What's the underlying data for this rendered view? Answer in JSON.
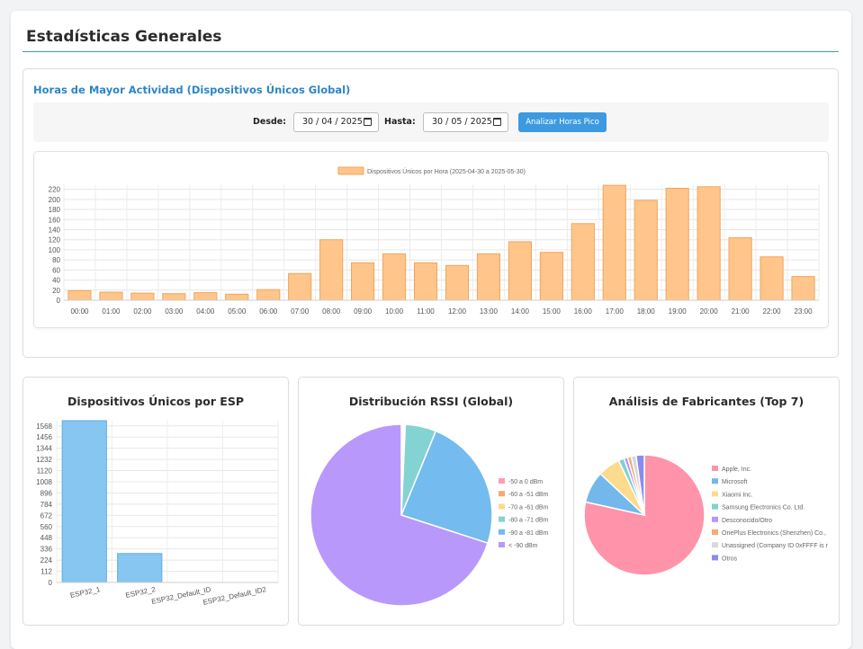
{
  "page": {
    "title": "Estadísticas Generales"
  },
  "peak_hours": {
    "title": "Horas de Mayor Actividad (Dispositivos Únicos Global)",
    "from_label": "Desde:",
    "from_value": "30 / 04 / 2025",
    "to_label": "Hasta:",
    "to_value": "30 / 05 / 2025",
    "analyze_button": "Analizar Horas Pico"
  },
  "esp_card": {
    "title": "Dispositivos Únicos por ESP"
  },
  "rssi_card": {
    "title": "Distribución RSSI (Global)"
  },
  "mfr_card": {
    "title": "Análisis de Fabricantes (Top 7)"
  },
  "chart_data": [
    {
      "type": "bar",
      "legend": "Dispositivos Únicos por Hora (2025-04-30 a 2025-05-30)",
      "categories": [
        "00:00",
        "01:00",
        "02:00",
        "03:00",
        "04:00",
        "05:00",
        "06:00",
        "07:00",
        "08:00",
        "09:00",
        "10:00",
        "11:00",
        "12:00",
        "13:00",
        "14:00",
        "15:00",
        "16:00",
        "17:00",
        "18:00",
        "19:00",
        "20:00",
        "21:00",
        "22:00",
        "23:00"
      ],
      "values": [
        19,
        16,
        14,
        13,
        15,
        12,
        21,
        53,
        120,
        74,
        92,
        74,
        69,
        92,
        116,
        95,
        152,
        228,
        198,
        222,
        225,
        124,
        86,
        47
      ],
      "ylim": [
        0,
        230
      ],
      "yticks": [
        0,
        20,
        40,
        60,
        80,
        100,
        120,
        140,
        160,
        180,
        200,
        220
      ],
      "color": "#ffc58a",
      "border": "#f3a55a",
      "grid": true
    },
    {
      "type": "bar",
      "categories": [
        "ESP32_1",
        "ESP32_2",
        "ESP32_Default_ID",
        "ESP32_Default_ID2"
      ],
      "values": [
        1620,
        290,
        0,
        0
      ],
      "ylim": [
        0,
        1620
      ],
      "yticks": [
        0,
        112,
        224,
        336,
        448,
        560,
        672,
        784,
        896,
        1008,
        1120,
        1232,
        1344,
        1456,
        1568
      ],
      "color": "#87c6f0",
      "border": "#5aaee8",
      "grid": true
    },
    {
      "type": "pie",
      "labels": [
        "-50 a 0 dBm",
        "-60 a -51 dBm",
        "-70 a -61 dBm",
        "-80 a -71 dBm",
        "-90 a -81 dBm",
        "< -90 dBm"
      ],
      "values": [
        0.3,
        0.2,
        0.2,
        5.5,
        23.8,
        70.0
      ],
      "colors": [
        "#ff9db0",
        "#f7a77b",
        "#fdd98a",
        "#84d3d3",
        "#74bbef",
        "#b998fc"
      ],
      "legend_position": "right"
    },
    {
      "type": "pie",
      "labels": [
        "Apple, Inc.",
        "Microsoft",
        "Xiaomi Inc.",
        "Samsung Electronics Co. Ltd.",
        "Desconocido/Otro",
        "OnePlus Electronics (Shenzhen) Co.,",
        "Unassigned (Company ID 0xFFFF is r",
        "Otros"
      ],
      "values": [
        78.5,
        8.5,
        6.0,
        1.5,
        1.0,
        1.0,
        1.3,
        2.2
      ],
      "colors": [
        "#ff93a9",
        "#72b8eb",
        "#fddb8c",
        "#82d1d1",
        "#b796fb",
        "#f8aa73",
        "#d8d8d8",
        "#8b8bee"
      ],
      "legend_position": "right"
    }
  ]
}
